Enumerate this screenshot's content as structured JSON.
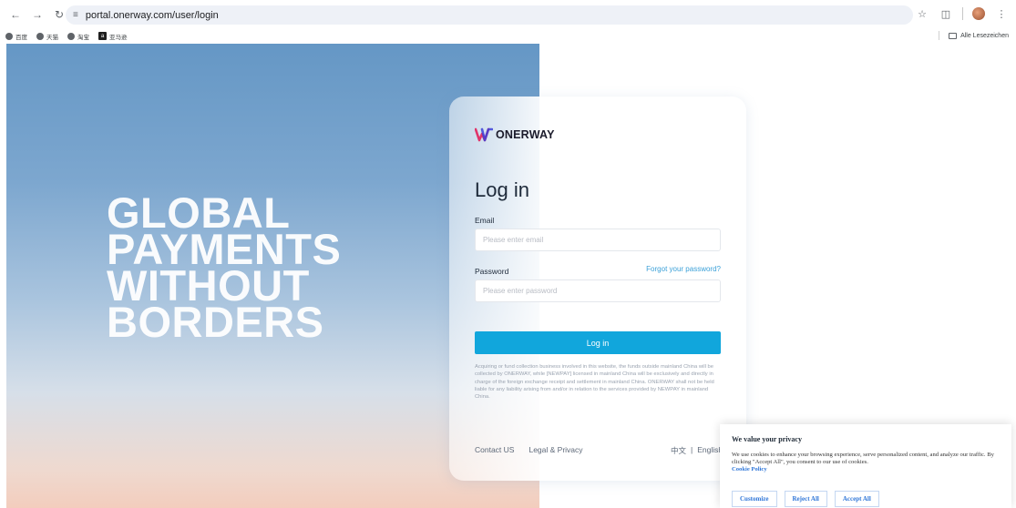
{
  "browser": {
    "url": "portal.onerway.com/user/login",
    "bookmarks": [
      {
        "label": "百度"
      },
      {
        "label": "天猫"
      },
      {
        "label": "淘宝"
      },
      {
        "label": "亚马逊"
      }
    ],
    "all_bookmarks_label": "Alle Lesezeichen"
  },
  "hero": {
    "line1": "GLOBAL",
    "line2": "PAYMENTS",
    "line3": "WITHOUT",
    "line4": "BORDERS"
  },
  "login": {
    "logo_text": "ONERWAY",
    "title": "Log in",
    "email_label": "Email",
    "email_placeholder": "Please enter email",
    "password_label": "Password",
    "password_placeholder": "Please enter password",
    "forgot_label": "Forgot your password?",
    "button_label": "Log in",
    "disclaimer": "Acquiring or fund collection business involved in this website, the funds outside mainland China will be collected by ONERWAY, while [NEWPAY] licensed in mainland China will be exclusively and directly in charge of the foreign exchange receipt and settlement in mainland China. ONERWAY shall not be held liable for any liability arising from and/or in relation to the services provided by NEWPAY in mainland China."
  },
  "footer": {
    "contact": "Contact US",
    "legal": "Legal & Privacy",
    "lang_zh": "中文",
    "lang_sep": "|",
    "lang_en": "English"
  },
  "cookie": {
    "title": "We value your privacy",
    "text": "We use cookies to enhance your browsing experience, serve personalized content, and analyze our traffic. By clicking \"Accept All\", you consent to our use of cookies.",
    "policy": "Cookie Policy",
    "customize": "Customize",
    "reject": "Reject All",
    "accept": "Accept All"
  }
}
